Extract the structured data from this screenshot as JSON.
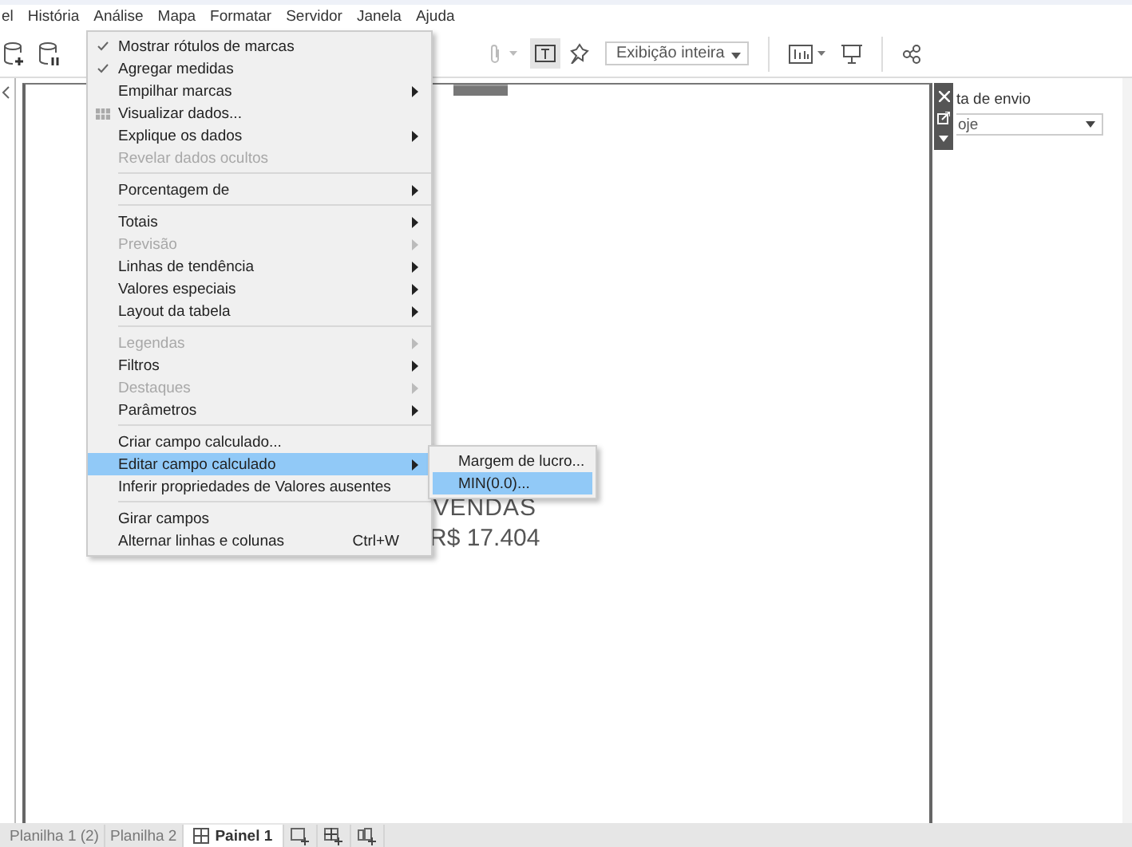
{
  "menubar": [
    {
      "label": "el"
    },
    {
      "label": "História"
    },
    {
      "label": "Análise"
    },
    {
      "label": "Mapa"
    },
    {
      "label": "Formatar"
    },
    {
      "label": "Servidor"
    },
    {
      "label": "Janela"
    },
    {
      "label": "Ajuda"
    }
  ],
  "toolbar": {
    "view_dropdown": "Exibição inteira",
    "text_toggle_on": true
  },
  "menu": [
    {
      "kind": "item",
      "label": "Mostrar rótulos de marcas",
      "checked": true,
      "disabled": false,
      "submenu": false,
      "selected": false
    },
    {
      "kind": "item",
      "label": "Agregar medidas",
      "checked": true,
      "disabled": false,
      "submenu": false,
      "selected": false
    },
    {
      "kind": "item",
      "label": "Empilhar marcas",
      "checked": false,
      "disabled": false,
      "submenu": true,
      "selected": false
    },
    {
      "kind": "table-item",
      "label": "Visualizar dados...",
      "checked": false,
      "disabled": false,
      "submenu": false,
      "selected": false
    },
    {
      "kind": "item",
      "label": "Explique os dados",
      "checked": false,
      "disabled": false,
      "submenu": true,
      "selected": false
    },
    {
      "kind": "item",
      "label": "Revelar dados ocultos",
      "checked": false,
      "disabled": true,
      "submenu": false,
      "selected": false
    },
    {
      "kind": "separator"
    },
    {
      "kind": "item",
      "label": "Porcentagem de",
      "checked": false,
      "disabled": false,
      "submenu": true,
      "selected": false
    },
    {
      "kind": "separator"
    },
    {
      "kind": "item",
      "label": "Totais",
      "checked": false,
      "disabled": false,
      "submenu": true,
      "selected": false
    },
    {
      "kind": "item",
      "label": "Previsão",
      "checked": false,
      "disabled": true,
      "submenu": true,
      "selected": false
    },
    {
      "kind": "item",
      "label": "Linhas de tendência",
      "checked": false,
      "disabled": false,
      "submenu": true,
      "selected": false
    },
    {
      "kind": "item",
      "label": "Valores especiais",
      "checked": false,
      "disabled": false,
      "submenu": true,
      "selected": false
    },
    {
      "kind": "item",
      "label": "Layout da tabela",
      "checked": false,
      "disabled": false,
      "submenu": true,
      "selected": false
    },
    {
      "kind": "separator"
    },
    {
      "kind": "item",
      "label": "Legendas",
      "checked": false,
      "disabled": true,
      "submenu": true,
      "selected": false
    },
    {
      "kind": "item",
      "label": "Filtros",
      "checked": false,
      "disabled": false,
      "submenu": true,
      "selected": false
    },
    {
      "kind": "item",
      "label": "Destaques",
      "checked": false,
      "disabled": true,
      "submenu": true,
      "selected": false
    },
    {
      "kind": "item",
      "label": "Parâmetros",
      "checked": false,
      "disabled": false,
      "submenu": true,
      "selected": false
    },
    {
      "kind": "separator"
    },
    {
      "kind": "item",
      "label": "Criar campo calculado...",
      "checked": false,
      "disabled": false,
      "submenu": false,
      "selected": false
    },
    {
      "kind": "item",
      "label": "Editar campo calculado",
      "checked": false,
      "disabled": false,
      "submenu": true,
      "selected": true
    },
    {
      "kind": "item",
      "label": "Inferir propriedades de Valores ausentes",
      "checked": false,
      "disabled": false,
      "submenu": false,
      "selected": false
    },
    {
      "kind": "separator"
    },
    {
      "kind": "item",
      "label": "Girar campos",
      "checked": false,
      "disabled": false,
      "submenu": false,
      "selected": false
    },
    {
      "kind": "item",
      "label": "Alternar linhas e colunas",
      "checked": false,
      "disabled": false,
      "submenu": false,
      "selected": false,
      "shortcut": "Ctrl+W"
    }
  ],
  "submenu": [
    {
      "label": "Margem de lucro...",
      "selected": false
    },
    {
      "label": "MIN(0.0)...",
      "selected": true
    }
  ],
  "kpi": {
    "title": "VENDAS",
    "value": "R$ 17.404"
  },
  "filter": {
    "label": "ta de envio",
    "value": "oje"
  },
  "tabs": [
    {
      "label": "Planilha 1 (2)",
      "selected": false,
      "kind": "sheet"
    },
    {
      "label": "Planilha 2",
      "selected": false,
      "kind": "sheet"
    },
    {
      "label": "Painel 1",
      "selected": true,
      "kind": "dashboard"
    }
  ]
}
